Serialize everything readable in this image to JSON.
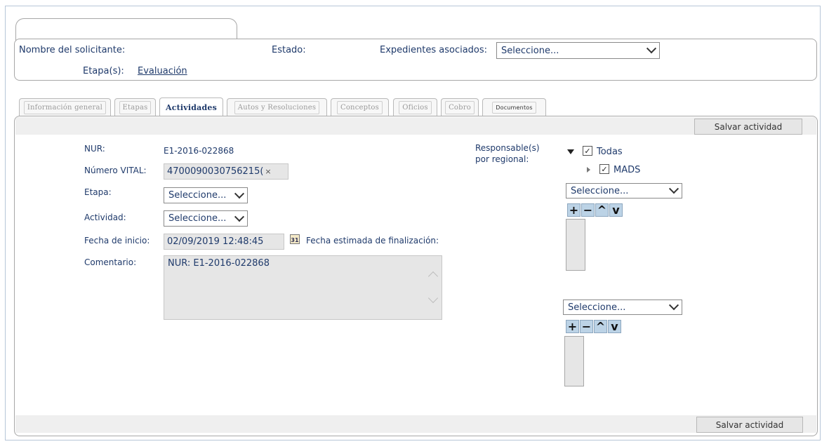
{
  "header": {
    "solicitante_label": "Nombre del solicitante:",
    "estado_label": "Estado:",
    "expedientes_label": "Expedientes asociados:",
    "expedientes_select": "Seleccione...",
    "etapas_label": "Etapa(s):",
    "etapas_link": "Evaluación"
  },
  "tabs": [
    {
      "label": "Información general"
    },
    {
      "label": "Etapas"
    },
    {
      "label": "Actividades"
    },
    {
      "label": "Autos y Resoluciones"
    },
    {
      "label": "Conceptos"
    },
    {
      "label": "Oficios"
    },
    {
      "label": "Cobro"
    },
    {
      "label": "Documentos"
    }
  ],
  "form": {
    "save_button": "Salvar actividad",
    "nur_label": "NUR:",
    "nur_value": "E1-2016-022868",
    "vital_label": "Número VITAL:",
    "vital_value": "4700090030756215(",
    "vital_clear": "×",
    "etapa_label": "Etapa:",
    "etapa_select": "Seleccione...",
    "actividad_label": "Actividad:",
    "actividad_select": "Seleccione...",
    "fecha_inicio_label": "Fecha de inicio:",
    "fecha_inicio_value": "02/09/2019 12:48:45",
    "calendar_text": "31",
    "fecha_fin_label": "Fecha estimada de finalización:",
    "comentario_label": "Comentario:",
    "comentario_value": "NUR: E1-2016-022868"
  },
  "responsables": {
    "label_line1": "Responsable(s)",
    "label_line2": "por regional:",
    "todas": "Todas",
    "mads": "MADS",
    "check": "✓",
    "select1": "Seleccione...",
    "select2": "Seleccione...",
    "btn_add": "+",
    "btn_remove": "−",
    "btn_up": "^",
    "btn_down": "v"
  },
  "icons": [
    "chevron-down-icon",
    "calendar-icon",
    "tree-expand-icon",
    "tree-collapse-icon",
    "clear-icon",
    "scroll-up-icon",
    "scroll-down-icon"
  ],
  "colors": {
    "text": "#1f3a6b",
    "panel_border": "#a7a7a7",
    "input_bg": "#e6e6e6",
    "button_blue": "#bcd3e6"
  }
}
